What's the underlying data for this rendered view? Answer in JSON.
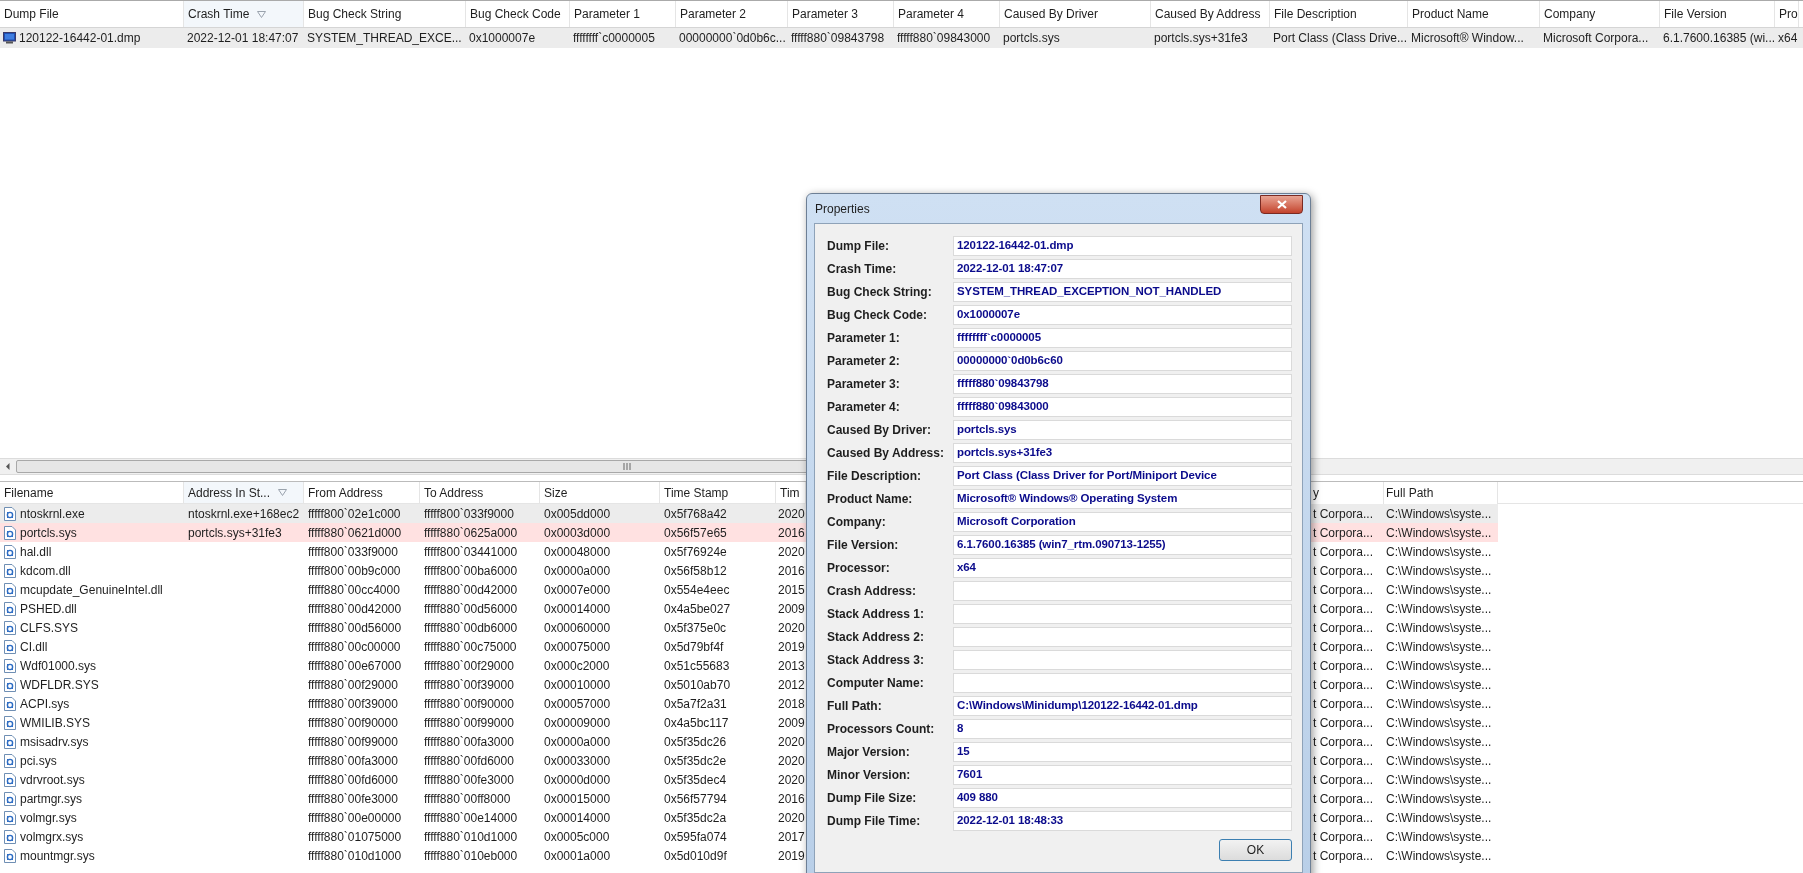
{
  "top_table": {
    "columns": [
      {
        "label": "Dump File",
        "sorted": false
      },
      {
        "label": "Crash Time",
        "sorted": true
      },
      {
        "label": "Bug Check String",
        "sorted": false
      },
      {
        "label": "Bug Check Code",
        "sorted": false
      },
      {
        "label": "Parameter 1",
        "sorted": false
      },
      {
        "label": "Parameter 2",
        "sorted": false
      },
      {
        "label": "Parameter 3",
        "sorted": false
      },
      {
        "label": "Parameter 4",
        "sorted": false
      },
      {
        "label": "Caused By Driver",
        "sorted": false
      },
      {
        "label": "Caused By Address",
        "sorted": false
      },
      {
        "label": "File Description",
        "sorted": false
      },
      {
        "label": "Product Name",
        "sorted": false
      },
      {
        "label": "Company",
        "sorted": false
      },
      {
        "label": "File Version",
        "sorted": false
      },
      {
        "label": "Pro",
        "sorted": false
      }
    ],
    "rows": [
      {
        "selected": true,
        "cells": [
          "120122-16442-01.dmp",
          "2022-12-01 18:47:07",
          "SYSTEM_THREAD_EXCE...",
          "0x1000007e",
          "ffffffff`c0000005",
          "00000000`0d0b6c...",
          "fffff880`09843798",
          "fffff880`09843000",
          "portcls.sys",
          "portcls.sys+31fe3",
          "Port Class (Class Drive...",
          "Microsoft® Window...",
          "Microsoft Corpora...",
          "6.1.7600.16385 (wi...",
          "x64"
        ]
      }
    ]
  },
  "bottom_table": {
    "columns": [
      {
        "label": "Filename",
        "sorted": false
      },
      {
        "label": "Address In St...",
        "sorted": true
      },
      {
        "label": "From Address",
        "sorted": false
      },
      {
        "label": "To Address",
        "sorted": false
      },
      {
        "label": "Size",
        "sorted": false
      },
      {
        "label": "Time Stamp",
        "sorted": false
      },
      {
        "label": "Tim",
        "sorted": false
      },
      {
        "label": "y",
        "sorted": false
      },
      {
        "label": "Full Path",
        "sorted": false
      }
    ],
    "rows": [
      {
        "selected": true,
        "highlighted": false,
        "cells": [
          "ntoskrnl.exe",
          "ntoskrnl.exe+168ec2",
          "fffff800`02e1c000",
          "fffff800`033f9000",
          "0x005dd000",
          "0x5f768a42",
          "2020",
          "t Corpora...",
          "C:\\Windows\\syste..."
        ]
      },
      {
        "selected": false,
        "highlighted": true,
        "cells": [
          "portcls.sys",
          "portcls.sys+31fe3",
          "fffff880`0621d000",
          "fffff880`0625a000",
          "0x0003d000",
          "0x56f57e65",
          "2016",
          "t Corpora...",
          "C:\\Windows\\syste..."
        ]
      },
      {
        "selected": false,
        "highlighted": false,
        "cells": [
          "hal.dll",
          "",
          "fffff800`033f9000",
          "fffff800`03441000",
          "0x00048000",
          "0x5f76924e",
          "2020",
          "t Corpora...",
          "C:\\Windows\\syste..."
        ]
      },
      {
        "selected": false,
        "highlighted": false,
        "cells": [
          "kdcom.dll",
          "",
          "fffff800`00b9c000",
          "fffff800`00ba6000",
          "0x0000a000",
          "0x56f58b12",
          "2016",
          "t Corpora...",
          "C:\\Windows\\syste..."
        ]
      },
      {
        "selected": false,
        "highlighted": false,
        "cells": [
          "mcupdate_GenuineIntel.dll",
          "",
          "fffff880`00cc4000",
          "fffff880`00d42000",
          "0x0007e000",
          "0x554e4eec",
          "2015",
          "t Corpora...",
          "C:\\Windows\\syste..."
        ]
      },
      {
        "selected": false,
        "highlighted": false,
        "cells": [
          "PSHED.dll",
          "",
          "fffff880`00d42000",
          "fffff880`00d56000",
          "0x00014000",
          "0x4a5be027",
          "2009",
          "t Corpora...",
          "C:\\Windows\\syste..."
        ]
      },
      {
        "selected": false,
        "highlighted": false,
        "cells": [
          "CLFS.SYS",
          "",
          "fffff880`00d56000",
          "fffff880`00db6000",
          "0x00060000",
          "0x5f375e0c",
          "2020",
          "t Corpora...",
          "C:\\Windows\\syste..."
        ]
      },
      {
        "selected": false,
        "highlighted": false,
        "cells": [
          "CI.dll",
          "",
          "fffff880`00c00000",
          "fffff880`00c75000",
          "0x00075000",
          "0x5d79bf4f",
          "2019",
          "t Corpora...",
          "C:\\Windows\\syste..."
        ]
      },
      {
        "selected": false,
        "highlighted": false,
        "cells": [
          "Wdf01000.sys",
          "",
          "fffff880`00e67000",
          "fffff880`00f29000",
          "0x000c2000",
          "0x51c55683",
          "2013",
          "t Corpora...",
          "C:\\Windows\\syste..."
        ]
      },
      {
        "selected": false,
        "highlighted": false,
        "cells": [
          "WDFLDR.SYS",
          "",
          "fffff880`00f29000",
          "fffff880`00f39000",
          "0x00010000",
          "0x5010ab70",
          "2012",
          "t Corpora...",
          "C:\\Windows\\syste..."
        ]
      },
      {
        "selected": false,
        "highlighted": false,
        "cells": [
          "ACPI.sys",
          "",
          "fffff880`00f39000",
          "fffff880`00f90000",
          "0x00057000",
          "0x5a7f2a31",
          "2018",
          "t Corpora...",
          "C:\\Windows\\syste..."
        ]
      },
      {
        "selected": false,
        "highlighted": false,
        "cells": [
          "WMILIB.SYS",
          "",
          "fffff880`00f90000",
          "fffff880`00f99000",
          "0x00009000",
          "0x4a5bc117",
          "2009",
          "t Corpora...",
          "C:\\Windows\\syste..."
        ]
      },
      {
        "selected": false,
        "highlighted": false,
        "cells": [
          "msisadrv.sys",
          "",
          "fffff880`00f99000",
          "fffff880`00fa3000",
          "0x0000a000",
          "0x5f35dc26",
          "2020",
          "t Corpora...",
          "C:\\Windows\\syste..."
        ]
      },
      {
        "selected": false,
        "highlighted": false,
        "cells": [
          "pci.sys",
          "",
          "fffff880`00fa3000",
          "fffff880`00fd6000",
          "0x00033000",
          "0x5f35dc2e",
          "2020",
          "t Corpora...",
          "C:\\Windows\\syste..."
        ]
      },
      {
        "selected": false,
        "highlighted": false,
        "cells": [
          "vdrvroot.sys",
          "",
          "fffff880`00fd6000",
          "fffff880`00fe3000",
          "0x0000d000",
          "0x5f35dec4",
          "2020",
          "t Corpora...",
          "C:\\Windows\\syste..."
        ]
      },
      {
        "selected": false,
        "highlighted": false,
        "cells": [
          "partmgr.sys",
          "",
          "fffff880`00fe3000",
          "fffff880`00ff8000",
          "0x00015000",
          "0x56f57794",
          "2016",
          "t Corpora...",
          "C:\\Windows\\syste..."
        ]
      },
      {
        "selected": false,
        "highlighted": false,
        "cells": [
          "volmgr.sys",
          "",
          "fffff880`00e00000",
          "fffff880`00e14000",
          "0x00014000",
          "0x5f35dc2a",
          "2020",
          "t Corpora...",
          "C:\\Windows\\syste..."
        ]
      },
      {
        "selected": false,
        "highlighted": false,
        "cells": [
          "volmgrx.sys",
          "",
          "fffff880`01075000",
          "fffff880`010d1000",
          "0x0005c000",
          "0x595fa074",
          "2017",
          "t Corpora...",
          "C:\\Windows\\syste..."
        ]
      },
      {
        "selected": false,
        "highlighted": false,
        "cells": [
          "mountmgr.sys",
          "",
          "fffff880`010d1000",
          "fffff880`010eb000",
          "0x0001a000",
          "0x5d010d9f",
          "2019",
          "t Corpora...",
          "C:\\Windows\\syste..."
        ]
      }
    ]
  },
  "dialog": {
    "title": "Properties",
    "fields": [
      {
        "label": "Dump File:",
        "value": "120122-16442-01.dmp"
      },
      {
        "label": "Crash Time:",
        "value": "2022-12-01 18:47:07"
      },
      {
        "label": "Bug Check String:",
        "value": "SYSTEM_THREAD_EXCEPTION_NOT_HANDLED"
      },
      {
        "label": "Bug Check Code:",
        "value": "0x1000007e"
      },
      {
        "label": "Parameter 1:",
        "value": "ffffffff`c0000005"
      },
      {
        "label": "Parameter 2:",
        "value": "00000000`0d0b6c60"
      },
      {
        "label": "Parameter 3:",
        "value": "fffff880`09843798"
      },
      {
        "label": "Parameter 4:",
        "value": "fffff880`09843000"
      },
      {
        "label": "Caused By Driver:",
        "value": "portcls.sys"
      },
      {
        "label": "Caused By Address:",
        "value": "portcls.sys+31fe3"
      },
      {
        "label": "File Description:",
        "value": "Port Class (Class Driver for Port/Miniport Device"
      },
      {
        "label": "Product Name:",
        "value": "Microsoft® Windows® Operating System"
      },
      {
        "label": "Company:",
        "value": "Microsoft Corporation"
      },
      {
        "label": "File Version:",
        "value": "6.1.7600.16385 (win7_rtm.090713-1255)"
      },
      {
        "label": "Processor:",
        "value": "x64"
      },
      {
        "label": "Crash Address:"
      },
      {
        "label": "Stack Address 1:"
      },
      {
        "label": "Stack Address 2:"
      },
      {
        "label": "Stack Address 3:"
      },
      {
        "label": "Computer Name:"
      },
      {
        "label": "Full Path:",
        "value": "C:\\Windows\\Minidump\\120122-16442-01.dmp"
      },
      {
        "label": "Processors Count:",
        "value": "8"
      },
      {
        "label": "Major Version:",
        "value": "15"
      },
      {
        "label": "Minor Version:",
        "value": "7601"
      },
      {
        "label": "Dump File Size:",
        "value": "409 880"
      },
      {
        "label": "Dump File Time:",
        "value": "2022-12-01 18:48:33"
      }
    ],
    "buttons": [
      "OK"
    ]
  }
}
